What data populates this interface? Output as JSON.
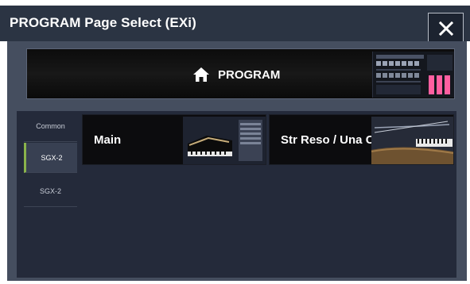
{
  "window": {
    "title": "PROGRAM Page Select (EXi)",
    "close_icon": "close-icon"
  },
  "program_button": {
    "label": "PROGRAM",
    "icon": "home-icon"
  },
  "sidebar": {
    "items": [
      {
        "label": "Common",
        "active": false
      },
      {
        "label": "SGX-2",
        "active": true
      },
      {
        "label": "SGX-2",
        "active": false
      }
    ]
  },
  "pages": [
    {
      "label": "Main"
    },
    {
      "label": "Str Reso / Una Corda"
    }
  ],
  "colors": {
    "titlebar": "#2b3443",
    "panel": "#454e5f",
    "inner": "#242a3a",
    "active_accent": "#8ab34b",
    "meter_pink": "#ff5fa0"
  }
}
